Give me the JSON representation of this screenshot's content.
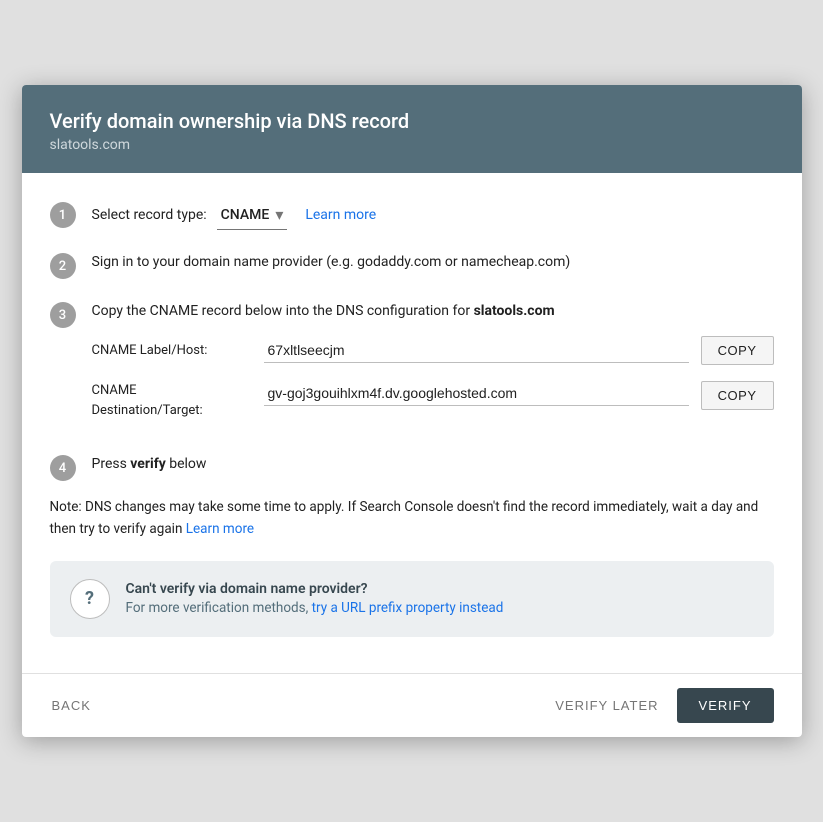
{
  "header": {
    "title": "Verify domain ownership via DNS record",
    "subtitle": "slatools.com"
  },
  "steps": {
    "step1": {
      "number": "1",
      "label": "Select record type:",
      "record_type": "CNAME",
      "learn_more": "Learn more"
    },
    "step2": {
      "number": "2",
      "text": "Sign in to your domain name provider (e.g. godaddy.com or namecheap.com)"
    },
    "step3": {
      "number": "3",
      "text_prefix": "Copy the CNAME record below into the DNS configuration for ",
      "domain": "slatools.com",
      "cname_label_field": {
        "label": "CNAME Label/Host:",
        "value": "67xltlseecjm",
        "copy_btn": "COPY"
      },
      "cname_destination_field": {
        "label": "CNAME\nDestination/Target:",
        "label_line1": "CNAME",
        "label_line2": "Destination/Target:",
        "value": "gv-goj3gouihlxm4f.dv.googlehosted.com",
        "copy_btn": "COPY"
      }
    },
    "step4": {
      "number": "4",
      "text_prefix": "Press ",
      "bold_word": "verify",
      "text_suffix": " below"
    }
  },
  "note": {
    "text": "Note: DNS changes may take some time to apply. If Search Console doesn't find the record immediately, wait a day and then try to verify again ",
    "link_text": "Learn more"
  },
  "cant_verify": {
    "title": "Can't verify via domain name provider?",
    "desc_prefix": "For more verification methods, ",
    "link_text": "try a URL prefix property instead"
  },
  "footer": {
    "back_label": "BACK",
    "verify_later_label": "VERIFY LATER",
    "verify_label": "VERIFY"
  }
}
